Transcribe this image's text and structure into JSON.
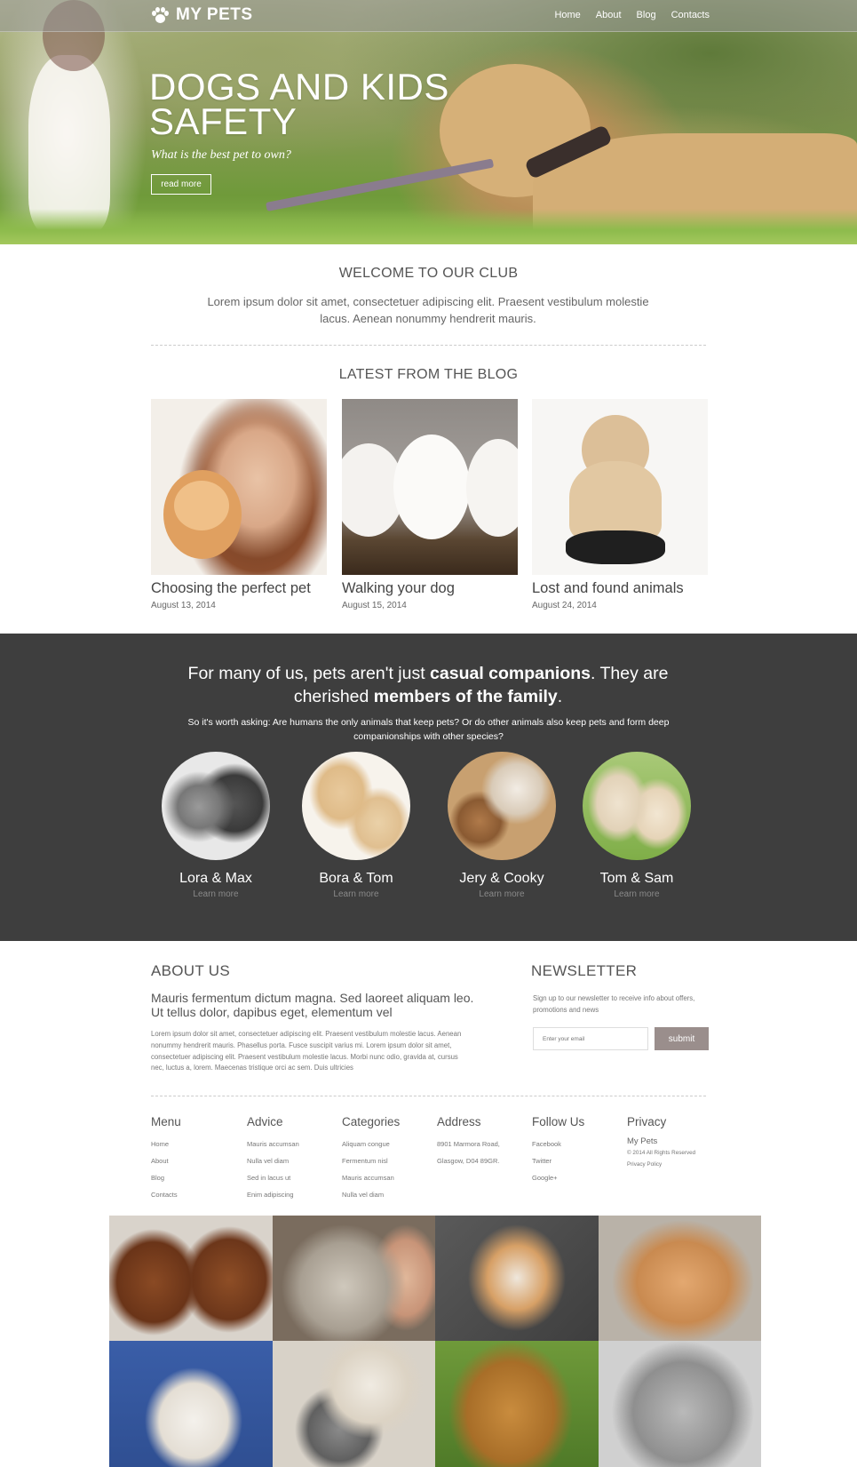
{
  "header": {
    "logo_text": "MY PETS",
    "nav": [
      "Home",
      "About",
      "Blog",
      "Contacts"
    ]
  },
  "hero": {
    "title_line1": "DOGS AND KIDS",
    "title_line2": "SAFETY",
    "subtitle": "What is the best pet to own?",
    "button": "read more"
  },
  "welcome": {
    "title": "WELCOME TO OUR CLUB",
    "text": "Lorem ipsum dolor sit amet, consectetuer adipiscing elit. Praesent vestibulum molestie lacus. Aenean nonummy hendrerit mauris."
  },
  "blog": {
    "title": "LATEST FROM THE BLOG",
    "posts": [
      {
        "title": "Choosing the perfect pet",
        "date": "August 13, 2014"
      },
      {
        "title": "Walking your dog",
        "date": "August 15, 2014"
      },
      {
        "title": "Lost and found animals",
        "date": "August 24, 2014"
      }
    ]
  },
  "quote": {
    "part1": "For many of us, pets aren't just ",
    "bold1": "casual companions",
    "part2": ". They are cherished ",
    "bold2": "members of the family",
    "part3": ".",
    "sub": "So it's worth asking: Are humans the only animals that keep pets? Or do other animals also keep pets and form deep companionships with other species?"
  },
  "pets": [
    {
      "name": "Lora & Max",
      "link": "Learn more"
    },
    {
      "name": "Bora & Tom",
      "link": "Learn more"
    },
    {
      "name": "Jery & Cooky",
      "link": "Learn more"
    },
    {
      "name": "Tom & Sam",
      "link": "Learn more"
    }
  ],
  "about": {
    "title": "ABOUT US",
    "lead": "Mauris fermentum dictum magna. Sed laoreet aliquam leo. Ut tellus dolor, dapibus eget, elementum vel",
    "text": "Lorem ipsum dolor sit amet, consectetuer adipiscing elit. Praesent vestibulum molestie lacus. Aenean nonummy hendrerit mauris. Phasellus porta. Fusce suscipit varius mi. Lorem ipsum dolor sit amet, consectetuer adipiscing elit. Praesent vestibulum molestie lacus. Morbi nunc odio, gravida at, cursus nec, luctus a, lorem. Maecenas tristique orci ac sem. Duis ultricies"
  },
  "newsletter": {
    "title": "NEWSLETTER",
    "text": "Sign up to our newsletter to receive info about offers, promotions and news",
    "placeholder": "Enter your email",
    "button": "submit"
  },
  "footer": {
    "menu": {
      "title": "Menu",
      "items": [
        "Home",
        "About",
        "Blog",
        "Contacts"
      ]
    },
    "advice": {
      "title": "Advice",
      "items": [
        "Mauris accumsan",
        "Nulla vel diam",
        "Sed in lacus ut",
        "Enim adipiscing"
      ]
    },
    "categories": {
      "title": "Categories",
      "items": [
        "Aliquam congue",
        "Fermentum nisl",
        "Mauris accumsan",
        "Nulla vel diam"
      ]
    },
    "address": {
      "title": "Address",
      "items": [
        "8901 Marmora Road,",
        "Glasgow, D04 89GR."
      ]
    },
    "follow": {
      "title": "Follow Us",
      "items": [
        "Facebook",
        "Twitter",
        "Google+"
      ]
    },
    "privacy": {
      "title": "Privacy",
      "brand": "My Pets",
      "copyright": "© 2014 All Rights Reserved",
      "policy": "Privacy Policy"
    }
  },
  "colors": {
    "dark_section": "#3e3e3e",
    "submit_button": "#9a8e8c",
    "text": "#555555"
  },
  "icons": {
    "logo": "paw-icon"
  }
}
